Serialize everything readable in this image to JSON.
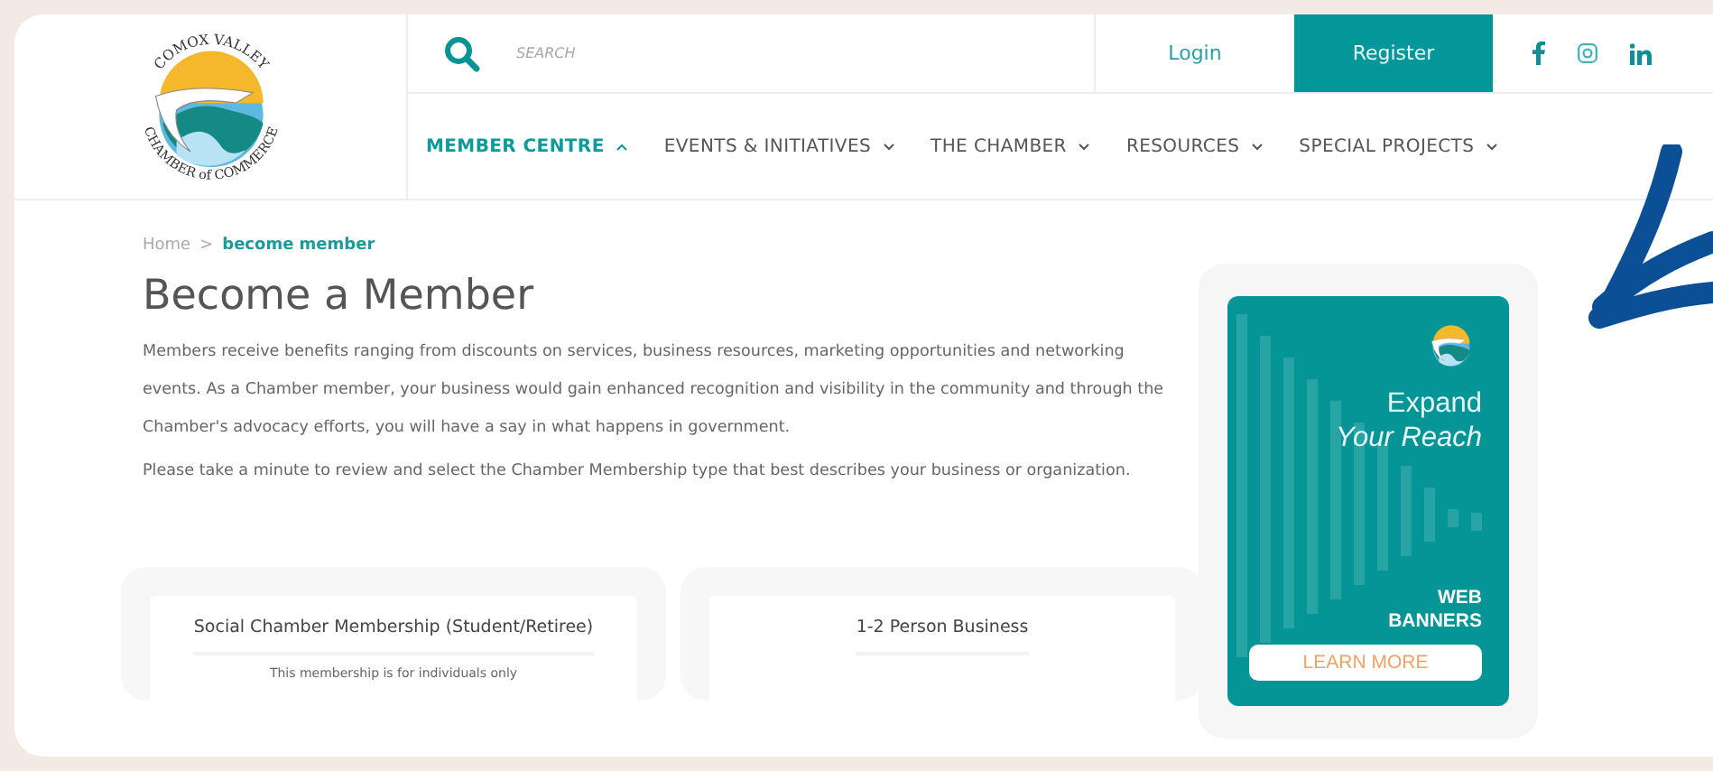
{
  "logo": {
    "top_text": "COMOX VALLEY",
    "bottom_text": "CHAMBER of COMMERCE"
  },
  "search": {
    "placeholder": "SEARCH"
  },
  "account_links": [
    {
      "label": "Login",
      "kind": "link"
    },
    {
      "label": "Register",
      "kind": "primary"
    }
  ],
  "nav": [
    {
      "label": "MEMBER CENTRE",
      "selected": true
    },
    {
      "label": "EVENTS & INITIATIVES",
      "selected": false
    },
    {
      "label": "THE CHAMBER",
      "selected": false
    },
    {
      "label": "RESOURCES",
      "selected": false
    },
    {
      "label": "SPECIAL PROJECTS",
      "selected": false
    }
  ],
  "breadcrumb": {
    "items": [
      "Home",
      "become member"
    ],
    "separator": ">"
  },
  "title": "Become a Member",
  "paragraphs": [
    "Members receive benefits ranging from discounts on services, business resources, marketing opportunities and networking events. As a Chamber member, your business would gain enhanced recognition and visibility in the community and through the Chamber's advocacy efforts, you will have a say in what happens in government.",
    "Please take a minute to review and select the Chamber Membership type that best describes your business or organization."
  ],
  "banner": {
    "headline": [
      "Expand",
      "Your Reach"
    ],
    "tag": [
      "WEB",
      "BANNERS"
    ],
    "button": "LEARN MORE"
  },
  "cards": [
    {
      "title": "Social Chamber Membership (Student/Retiree)",
      "description": "This membership is for individuals only"
    },
    {
      "title": "1-2 Person Business"
    }
  ]
}
